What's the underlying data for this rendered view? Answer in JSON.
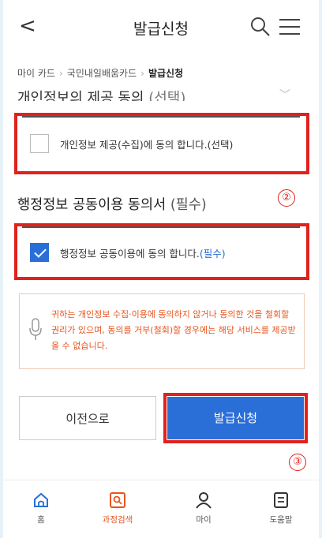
{
  "header": {
    "title": "발급신청"
  },
  "breadcrumb": {
    "items": [
      "마이 카드",
      "국민내일배움카드"
    ],
    "current": "발급신청"
  },
  "section1": {
    "title": "개인정보의 제공 동의",
    "tag": "(선택)",
    "checkbox_label": "개인정보 제공(수집)에 동의 합니다.(선택)",
    "checked": false
  },
  "section2": {
    "title": "행정정보 공동이용 동의서",
    "tag": "(필수)",
    "checkbox_label": "행정정보 공동이용에 동의 합니다.",
    "checkbox_req": "(필수)",
    "checked": true
  },
  "annotations": {
    "two": "②",
    "three": "③"
  },
  "notice": {
    "text": "귀하는 개인정보 수집·이용에 동의하지 않거나 동의한 것을 철회할 권리가 있으며, 동의를 거부(철회)할 경우에는 해당 서비스를 제공받을 수 없습니다."
  },
  "buttons": {
    "prev": "이전으로",
    "apply": "발급신청"
  },
  "tabbar": {
    "home": "홈",
    "course_search": "과정검색",
    "my": "마이",
    "help": "도움말"
  },
  "colors": {
    "accent_blue": "#2a6ed8",
    "annotation_red": "#e0211c",
    "notice_orange": "#e8551e"
  }
}
